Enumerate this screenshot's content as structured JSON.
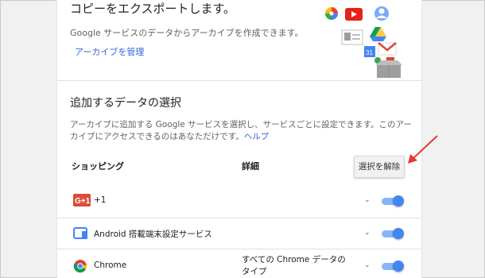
{
  "export": {
    "heading": "コピーをエクスポートします。",
    "subtext": "Google サービスのデータからアーカイブを作成できます。",
    "manage_link": "アーカイブを管理"
  },
  "select": {
    "heading": "追加するデータの選択",
    "description": "アーカイブに追加する Google サービスを選択し、サービスごとに設定できます。このアーカイブにアクセスできるのはあなただけです。",
    "help_link": "ヘルプ",
    "col_service": "ショッピング",
    "col_detail": "詳細",
    "deselect_button": "選択を解除"
  },
  "services": [
    {
      "name": "+1",
      "icon": "google-plus-one-icon",
      "detail": "",
      "enabled": true
    },
    {
      "name": "Android 搭載端末設定サービス",
      "icon": "android-device-icon",
      "detail": "",
      "enabled": true
    },
    {
      "name": "Chrome",
      "icon": "chrome-icon",
      "detail": "すべての Chrome データのタイプ",
      "enabled": true
    }
  ],
  "colors": {
    "link": "#3367d6",
    "toggle_track": "#8ab4f8",
    "toggle_knob": "#4285f4",
    "annotation_arrow": "#e53935"
  }
}
